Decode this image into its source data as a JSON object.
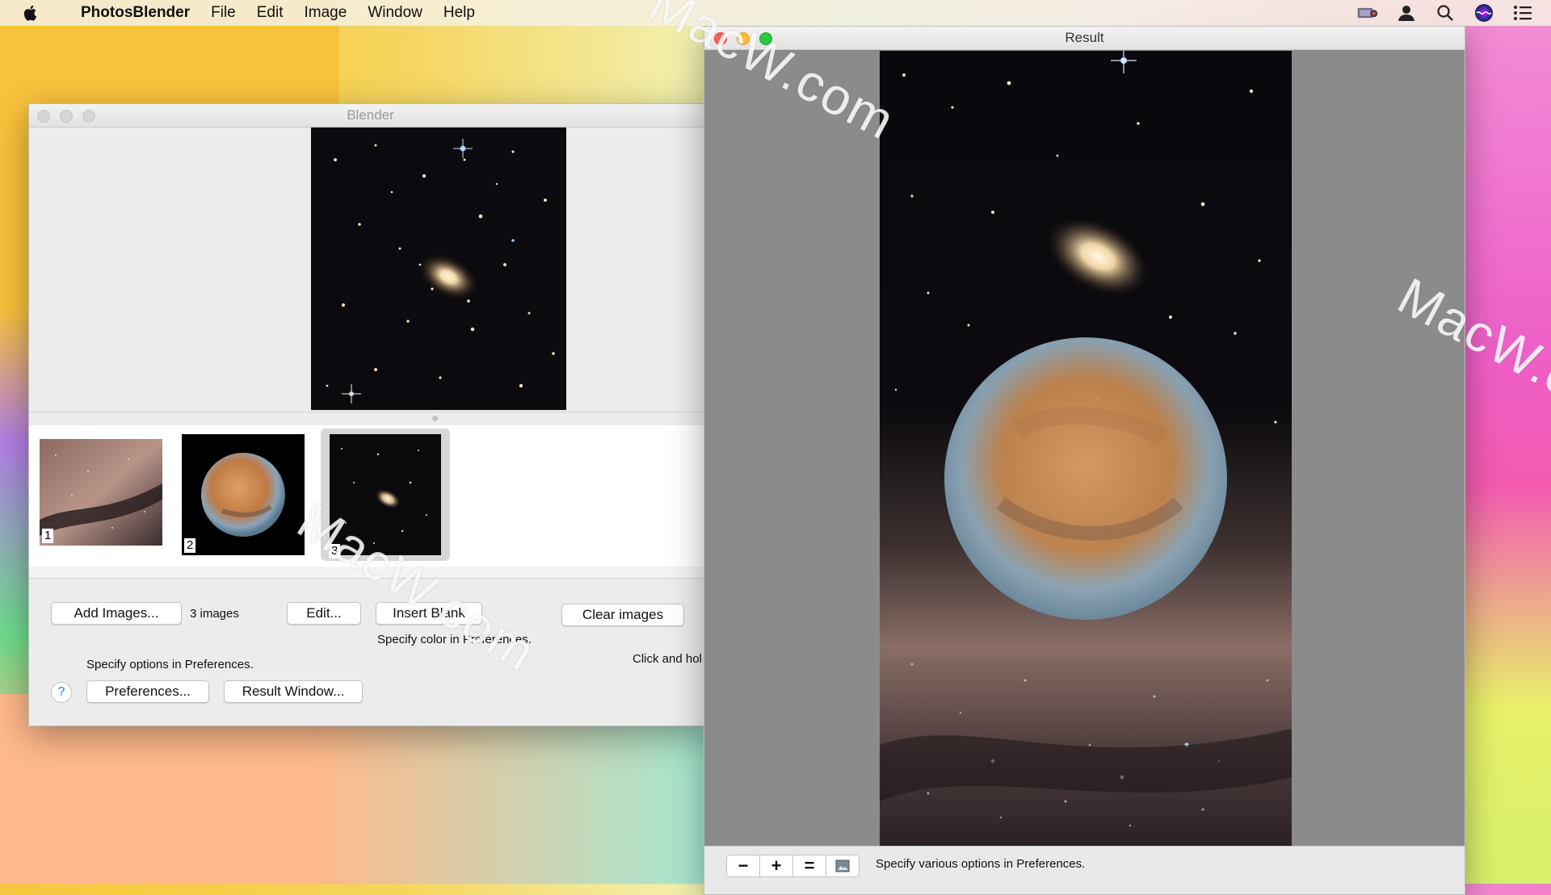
{
  "menubar": {
    "app_name": "PhotosBlender",
    "items": [
      "File",
      "Edit",
      "Image",
      "Window",
      "Help"
    ]
  },
  "blender": {
    "title": "Blender",
    "thumbnails": [
      {
        "num": "1",
        "kind": "milky-way"
      },
      {
        "num": "2",
        "kind": "mars"
      },
      {
        "num": "3",
        "kind": "galaxy-cluster"
      }
    ],
    "buttons": {
      "add_images": "Add Images...",
      "edit": "Edit...",
      "insert_blank": "Insert Blank",
      "clear_images": "Clear images",
      "preferences": "Preferences...",
      "result_window": "Result Window..."
    },
    "labels": {
      "image_count": "3 images",
      "specify_color": "Specify color in Preferences.",
      "specify_options": "Specify options in Preferences.",
      "click_and_hold": "Click and hol"
    },
    "help": "?"
  },
  "result": {
    "title": "Result",
    "status": "Specify various options in Preferences.",
    "zoom": {
      "minus": "−",
      "plus": "+",
      "equal": "="
    }
  },
  "watermarks": [
    "MacW.com",
    "MacW.com",
    "MacW.co"
  ],
  "colors": {
    "close": "#fc5f57",
    "minimize": "#fdbc2e",
    "zoom": "#28c840",
    "help_accent": "#2a7ae2"
  }
}
